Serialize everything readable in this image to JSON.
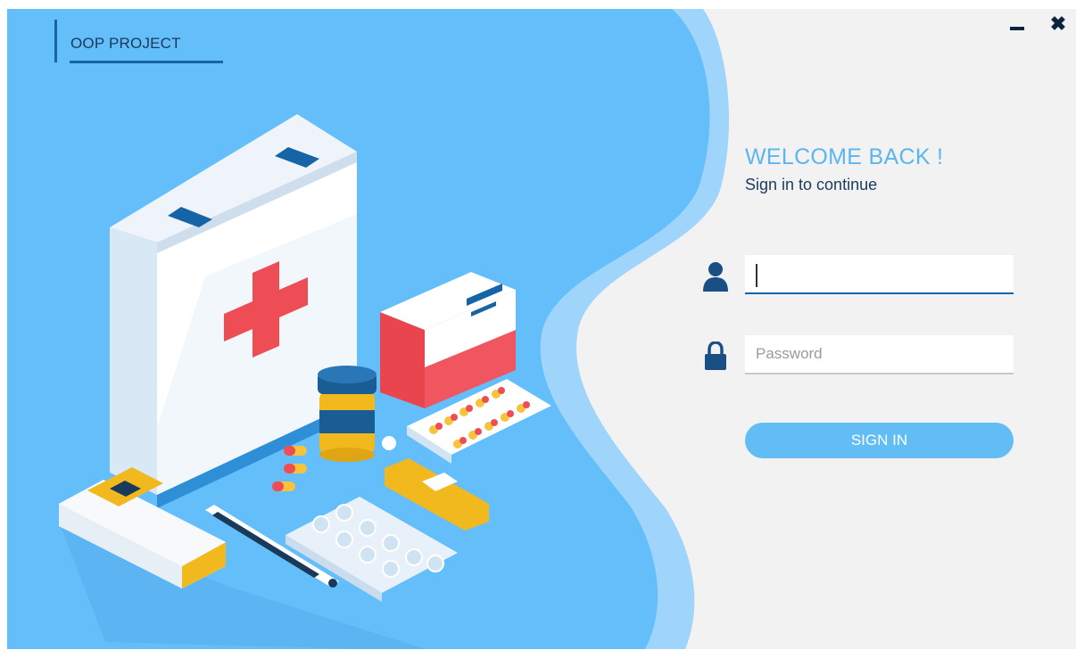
{
  "app": {
    "title": "OOP PROJECT"
  },
  "window_controls": {
    "minimize_icon": "minimize-icon",
    "close_icon": "close-icon",
    "close_glyph": "✖"
  },
  "login": {
    "heading": "WELCOME BACK !",
    "subheading": "Sign in to continue",
    "username": {
      "icon": "user-icon",
      "value": "",
      "placeholder": ""
    },
    "password": {
      "icon": "lock-icon",
      "value": "",
      "placeholder": "Password"
    },
    "signin_label": "SIGN IN"
  },
  "colors": {
    "panel_blue": "#63bef9",
    "wave_light": "#9fd4fb",
    "right_bg": "#f2f2f2",
    "accent_dark": "#1565a6",
    "heading_blue": "#5bb6ee",
    "button_blue": "#63bdf5"
  },
  "illustration": {
    "name": "medical-kit-illustration"
  }
}
